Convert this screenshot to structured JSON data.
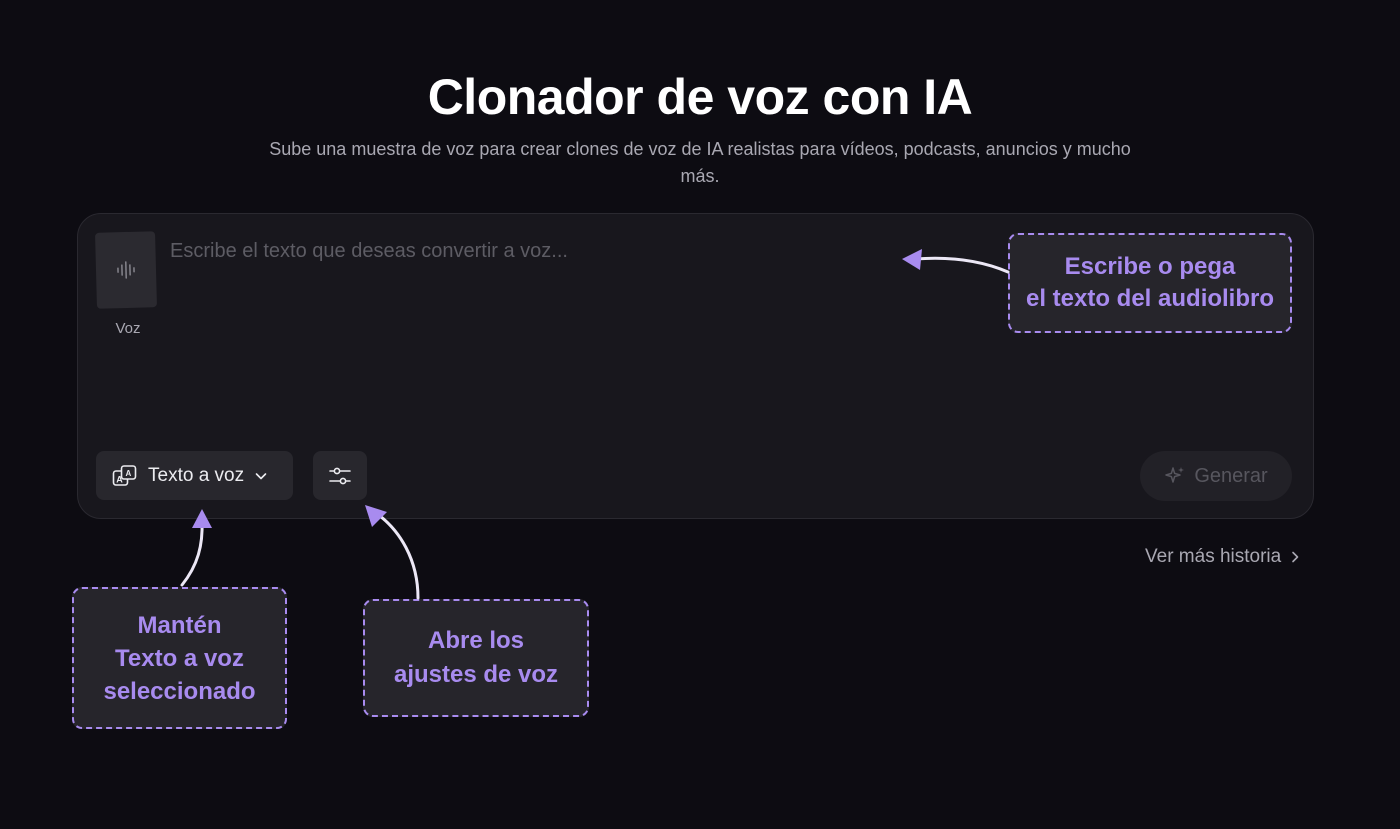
{
  "header": {
    "title": "Clonador de voz con IA",
    "subtitle": "Sube una muestra de voz para crear clones de voz de IA realistas para vídeos, podcasts, anuncios y mucho más."
  },
  "editor": {
    "voice_label": "Voz",
    "voice_icon": "waveform-icon",
    "text_placeholder": "Escribe el texto que deseas convertir a voz...",
    "mode_label": "Texto a voz",
    "mode_icon": "text-to-speech-icon",
    "settings_icon": "sliders-icon",
    "generate_label": "Generar",
    "generate_icon": "sparkles-icon"
  },
  "history_link": "Ver más historia",
  "callouts": {
    "text_hint": [
      "Escribe o pega",
      "el texto del audiolibro"
    ],
    "mode_hint": [
      "Mantén",
      "Texto a voz",
      "seleccionado"
    ],
    "settings_hint": [
      "Abre los",
      "ajustes de voz"
    ]
  },
  "colors": {
    "background": "#0d0c12",
    "panel": "#18171d",
    "accent": "#a88bef",
    "button": "#28272d"
  }
}
